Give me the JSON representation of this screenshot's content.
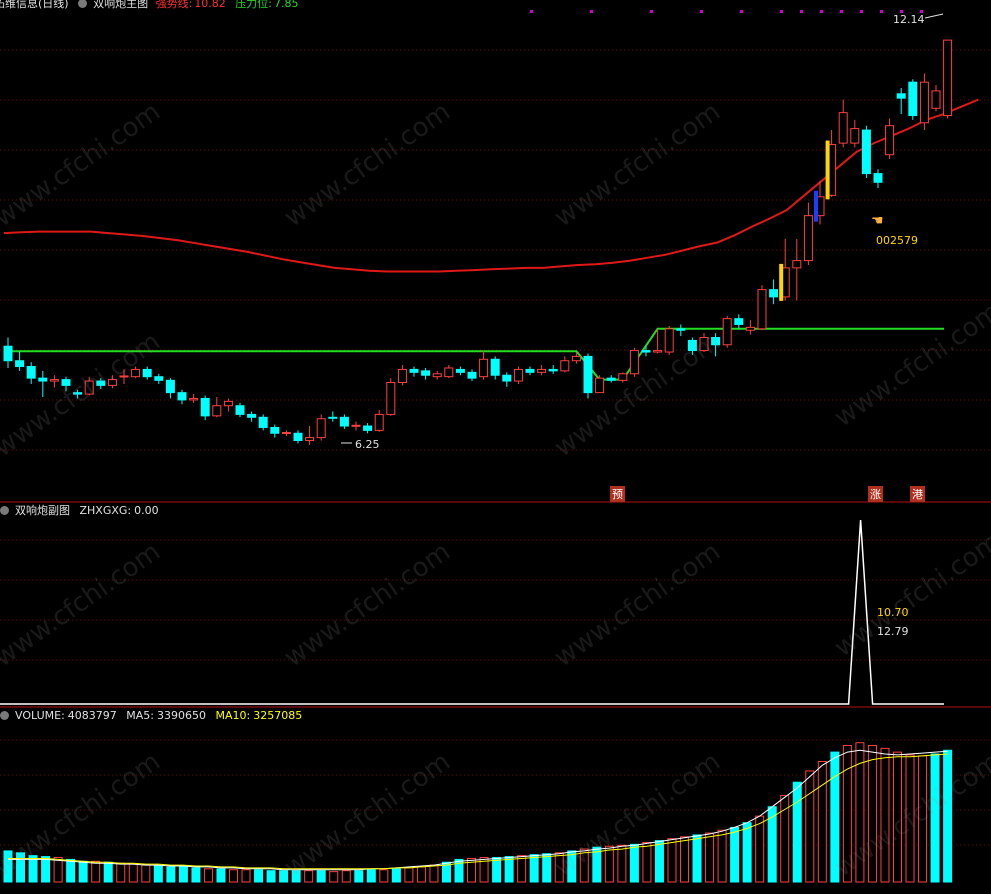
{
  "header": {
    "title": "拓维信息(日线)",
    "indicator_name": "双响炮主图",
    "trend_label": "强势线:",
    "trend_value": "10.82",
    "pressure_label": "压力位:",
    "pressure_value": "7.85"
  },
  "sub_panel": {
    "title": "双响炮副图",
    "zhxgxg_label": "ZHXGXG:",
    "zhxgxg_value": "0.00",
    "annot_1": "10.70",
    "annot_2": "12.79"
  },
  "volume_panel": {
    "label": "VOLUME:",
    "value": "4083797",
    "ma5_label": "MA5:",
    "ma5_value": "3390650",
    "ma10_label": "MA10:",
    "ma10_value": "3257085"
  },
  "annotations": {
    "high": "12.14",
    "low": "6.25",
    "stock_code": "002579",
    "marker_yu": "预",
    "marker_zhang": "涨",
    "marker_gang": "港",
    "watermark": "www.cfchi.com"
  },
  "colors": {
    "background": "#000000",
    "up": "#ff4040",
    "down": "#00ffff",
    "trend_line": "#e01818",
    "pressure_line": "#22dd22",
    "ma10": "#ffff00",
    "ma5": "#ffffff",
    "highlight_yellow": "#ffd700",
    "highlight_blue": "#1e3cff",
    "grid": "#7a0000"
  },
  "chart_data": {
    "type": "candlestick",
    "price_range": [
      5.8,
      12.5
    ],
    "candles": [
      {
        "o": 7.92,
        "c": 7.72,
        "h": 8.04,
        "l": 7.62
      },
      {
        "o": 7.72,
        "c": 7.64,
        "h": 7.85,
        "l": 7.58
      },
      {
        "o": 7.64,
        "c": 7.48,
        "h": 7.7,
        "l": 7.4
      },
      {
        "o": 7.48,
        "c": 7.44,
        "h": 7.58,
        "l": 7.22
      },
      {
        "o": 7.44,
        "c": 7.46,
        "h": 7.52,
        "l": 7.35
      },
      {
        "o": 7.46,
        "c": 7.38,
        "h": 7.5,
        "l": 7.3
      },
      {
        "o": 7.28,
        "c": 7.26,
        "h": 7.32,
        "l": 7.2
      },
      {
        "o": 7.26,
        "c": 7.44,
        "h": 7.5,
        "l": 7.24
      },
      {
        "o": 7.44,
        "c": 7.38,
        "h": 7.48,
        "l": 7.33
      },
      {
        "o": 7.38,
        "c": 7.46,
        "h": 7.52,
        "l": 7.34
      },
      {
        "o": 7.5,
        "c": 7.51,
        "h": 7.6,
        "l": 7.4
      },
      {
        "o": 7.5,
        "c": 7.6,
        "h": 7.64,
        "l": 7.48
      },
      {
        "o": 7.6,
        "c": 7.5,
        "h": 7.64,
        "l": 7.46
      },
      {
        "o": 7.5,
        "c": 7.45,
        "h": 7.54,
        "l": 7.4
      },
      {
        "o": 7.45,
        "c": 7.28,
        "h": 7.48,
        "l": 7.2
      },
      {
        "o": 7.28,
        "c": 7.18,
        "h": 7.32,
        "l": 7.12
      },
      {
        "o": 7.18,
        "c": 7.2,
        "h": 7.26,
        "l": 7.14
      },
      {
        "o": 7.2,
        "c": 6.96,
        "h": 7.24,
        "l": 6.9
      },
      {
        "o": 6.96,
        "c": 7.1,
        "h": 7.22,
        "l": 6.94
      },
      {
        "o": 7.1,
        "c": 7.16,
        "h": 7.2,
        "l": 7.02
      },
      {
        "o": 7.1,
        "c": 6.98,
        "h": 7.14,
        "l": 6.94
      },
      {
        "o": 6.98,
        "c": 6.94,
        "h": 7.02,
        "l": 6.88
      },
      {
        "o": 6.94,
        "c": 6.8,
        "h": 6.98,
        "l": 6.76
      },
      {
        "o": 6.8,
        "c": 6.72,
        "h": 6.84,
        "l": 6.66
      },
      {
        "o": 6.72,
        "c": 6.73,
        "h": 6.76,
        "l": 6.68
      },
      {
        "o": 6.72,
        "c": 6.62,
        "h": 6.76,
        "l": 6.58
      },
      {
        "o": 6.62,
        "c": 6.66,
        "h": 6.82,
        "l": 6.56
      },
      {
        "o": 6.66,
        "c": 6.92,
        "h": 6.98,
        "l": 6.62
      },
      {
        "o": 6.94,
        "c": 6.93,
        "h": 7.02,
        "l": 6.88
      },
      {
        "o": 6.94,
        "c": 6.82,
        "h": 6.98,
        "l": 6.78
      },
      {
        "o": 6.82,
        "c": 6.83,
        "h": 6.88,
        "l": 6.76
      },
      {
        "o": 6.82,
        "c": 6.76,
        "h": 6.86,
        "l": 6.72
      },
      {
        "o": 6.76,
        "c": 6.98,
        "h": 7.04,
        "l": 6.74
      },
      {
        "o": 6.98,
        "c": 7.42,
        "h": 7.48,
        "l": 6.96
      },
      {
        "o": 7.42,
        "c": 7.6,
        "h": 7.66,
        "l": 7.38
      },
      {
        "o": 7.6,
        "c": 7.56,
        "h": 7.64,
        "l": 7.5
      },
      {
        "o": 7.58,
        "c": 7.52,
        "h": 7.62,
        "l": 7.46
      },
      {
        "o": 7.5,
        "c": 7.54,
        "h": 7.58,
        "l": 7.46
      },
      {
        "o": 7.5,
        "c": 7.62,
        "h": 7.66,
        "l": 7.48
      },
      {
        "o": 7.6,
        "c": 7.56,
        "h": 7.64,
        "l": 7.52
      },
      {
        "o": 7.56,
        "c": 7.48,
        "h": 7.6,
        "l": 7.44
      },
      {
        "o": 7.5,
        "c": 7.74,
        "h": 7.86,
        "l": 7.46
      },
      {
        "o": 7.74,
        "c": 7.52,
        "h": 7.78,
        "l": 7.46
      },
      {
        "o": 7.52,
        "c": 7.44,
        "h": 7.56,
        "l": 7.36
      },
      {
        "o": 7.44,
        "c": 7.6,
        "h": 7.64,
        "l": 7.4
      },
      {
        "o": 7.6,
        "c": 7.56,
        "h": 7.64,
        "l": 7.52
      },
      {
        "o": 7.56,
        "c": 7.6,
        "h": 7.66,
        "l": 7.52
      },
      {
        "o": 7.6,
        "c": 7.58,
        "h": 7.66,
        "l": 7.54
      },
      {
        "o": 7.58,
        "c": 7.72,
        "h": 7.78,
        "l": 7.56
      },
      {
        "o": 7.72,
        "c": 7.78,
        "h": 7.84,
        "l": 7.68
      },
      {
        "o": 7.78,
        "c": 7.28,
        "h": 7.82,
        "l": 7.2
      },
      {
        "o": 7.28,
        "c": 7.48,
        "h": 7.52,
        "l": 7.28
      },
      {
        "o": 7.48,
        "c": 7.45,
        "h": 7.52,
        "l": 7.42
      },
      {
        "o": 7.45,
        "c": 7.54,
        "h": 7.56,
        "l": 7.42
      },
      {
        "o": 7.54,
        "c": 7.86,
        "h": 7.9,
        "l": 7.5
      },
      {
        "o": 7.86,
        "c": 7.84,
        "h": 7.92,
        "l": 7.78
      },
      {
        "o": 7.84,
        "c": 7.86,
        "h": 8.16,
        "l": 7.82
      },
      {
        "o": 7.84,
        "c": 8.16,
        "h": 8.2,
        "l": 7.8
      },
      {
        "o": 8.16,
        "c": 8.14,
        "h": 8.22,
        "l": 8.06
      },
      {
        "o": 8.0,
        "c": 7.86,
        "h": 8.04,
        "l": 7.8
      },
      {
        "o": 7.86,
        "c": 8.04,
        "h": 8.1,
        "l": 7.84
      },
      {
        "o": 8.04,
        "c": 7.94,
        "h": 8.1,
        "l": 7.78
      },
      {
        "o": 7.94,
        "c": 8.3,
        "h": 8.34,
        "l": 7.9
      },
      {
        "o": 8.3,
        "c": 8.22,
        "h": 8.36,
        "l": 8.16
      },
      {
        "o": 8.14,
        "c": 8.18,
        "h": 8.28,
        "l": 8.08
      },
      {
        "o": 8.16,
        "c": 8.7,
        "h": 8.76,
        "l": 8.14
      },
      {
        "o": 8.7,
        "c": 8.6,
        "h": 8.84,
        "l": 8.5
      },
      {
        "o": 8.6,
        "c": 9.0,
        "h": 9.4,
        "l": 8.55
      },
      {
        "o": 9.0,
        "c": 9.1,
        "h": 9.4,
        "l": 8.55
      },
      {
        "o": 9.1,
        "c": 9.72,
        "h": 9.9,
        "l": 9.04
      },
      {
        "o": 9.72,
        "c": 9.98,
        "h": 10.2,
        "l": 9.6
      },
      {
        "o": 10.0,
        "c": 10.7,
        "h": 10.9,
        "l": 9.98
      },
      {
        "o": 10.72,
        "c": 11.14,
        "h": 11.32,
        "l": 10.66
      },
      {
        "o": 10.72,
        "c": 10.92,
        "h": 11.04,
        "l": 10.66
      },
      {
        "o": 10.9,
        "c": 10.3,
        "h": 10.96,
        "l": 10.24
      },
      {
        "o": 10.3,
        "c": 10.18,
        "h": 10.36,
        "l": 10.1
      },
      {
        "o": 10.56,
        "c": 10.96,
        "h": 11.06,
        "l": 10.5
      },
      {
        "o": 11.4,
        "c": 11.34,
        "h": 11.48,
        "l": 11.12
      },
      {
        "o": 11.56,
        "c": 11.1,
        "h": 11.6,
        "l": 11.04
      },
      {
        "o": 11.0,
        "c": 11.56,
        "h": 11.68,
        "l": 10.9
      },
      {
        "o": 11.2,
        "c": 11.44,
        "h": 11.52,
        "l": 11.16
      },
      {
        "o": 11.1,
        "c": 12.14,
        "h": 12.14,
        "l": 11.06
      }
    ],
    "trend_line": [
      9.48,
      9.49,
      9.5,
      9.5,
      9.5,
      9.5,
      9.48,
      9.46,
      9.44,
      9.41,
      9.38,
      9.34,
      9.3,
      9.26,
      9.22,
      9.17,
      9.12,
      9.08,
      9.04,
      9.0,
      8.98,
      8.96,
      8.95,
      8.95,
      8.95,
      8.95,
      8.96,
      8.97,
      8.98,
      8.99,
      9.0,
      9.0,
      9.02,
      9.04,
      9.05,
      9.07,
      9.1,
      9.14,
      9.18,
      9.24,
      9.3,
      9.35,
      9.45,
      9.57,
      9.68,
      9.8,
      10.0,
      10.2,
      10.4,
      10.6,
      10.72,
      10.82,
      10.92,
      11.04,
      11.12,
      11.22,
      11.32
    ],
    "trend_start_index": 0,
    "pressure_line": {
      "levels": [
        {
          "from": 0,
          "to": 49,
          "value": 7.85
        },
        {
          "from": 51,
          "to": 53,
          "value": 7.46
        },
        {
          "from": 56,
          "to": 80,
          "value": 8.16
        }
      ]
    },
    "yellow_bars": [
      67,
      71
    ],
    "blue_bars": [
      70
    ],
    "signal_spike": {
      "index": 70,
      "value": 1
    },
    "volume": {
      "values": [
        33,
        31,
        28,
        27,
        26,
        24,
        22,
        22,
        21,
        20,
        19,
        18,
        17,
        16,
        16,
        15,
        14,
        14,
        13,
        13,
        13,
        12,
        12,
        12,
        12,
        12,
        11,
        12,
        12,
        13,
        13,
        14,
        15,
        16,
        18,
        21,
        24,
        25,
        26,
        26,
        27,
        28,
        29,
        30,
        31,
        33,
        35,
        37,
        38,
        39,
        40,
        42,
        44,
        46,
        48,
        50,
        52,
        55,
        58,
        63,
        70,
        80,
        92,
        106,
        118,
        128,
        138,
        145,
        148,
        145,
        142,
        138,
        135,
        134,
        136,
        140
      ],
      "ma5": [
        24,
        24,
        24,
        24,
        23,
        22,
        21,
        20,
        20,
        19,
        19,
        18,
        18,
        17,
        17,
        16,
        16,
        15,
        15,
        14,
        14,
        14,
        13,
        13,
        13,
        13,
        13,
        13,
        13,
        14,
        14,
        15,
        16,
        17,
        18,
        20,
        22,
        23,
        24,
        25,
        26,
        27,
        28,
        29,
        30,
        32,
        33,
        35,
        36,
        38,
        39,
        41,
        43,
        45,
        47,
        49,
        51,
        54,
        58,
        63,
        70,
        80,
        90,
        100,
        112,
        124,
        132,
        138,
        140,
        138,
        136,
        135,
        136,
        137,
        138,
        139
      ],
      "ma10": [
        25,
        25,
        25,
        25,
        24,
        23,
        22,
        21,
        21,
        20,
        20,
        19,
        19,
        18,
        18,
        17,
        17,
        16,
        16,
        15,
        15,
        15,
        14,
        14,
        14,
        14,
        14,
        14,
        14,
        14,
        14,
        15,
        15,
        16,
        17,
        18,
        20,
        21,
        22,
        23,
        24,
        25,
        26,
        27,
        28,
        29,
        31,
        32,
        34,
        35,
        37,
        38,
        40,
        42,
        44,
        46,
        48,
        50,
        53,
        57,
        62,
        69,
        77,
        85,
        94,
        103,
        112,
        120,
        126,
        130,
        132,
        133,
        133,
        134,
        135,
        136
      ],
      "max": 170
    }
  }
}
